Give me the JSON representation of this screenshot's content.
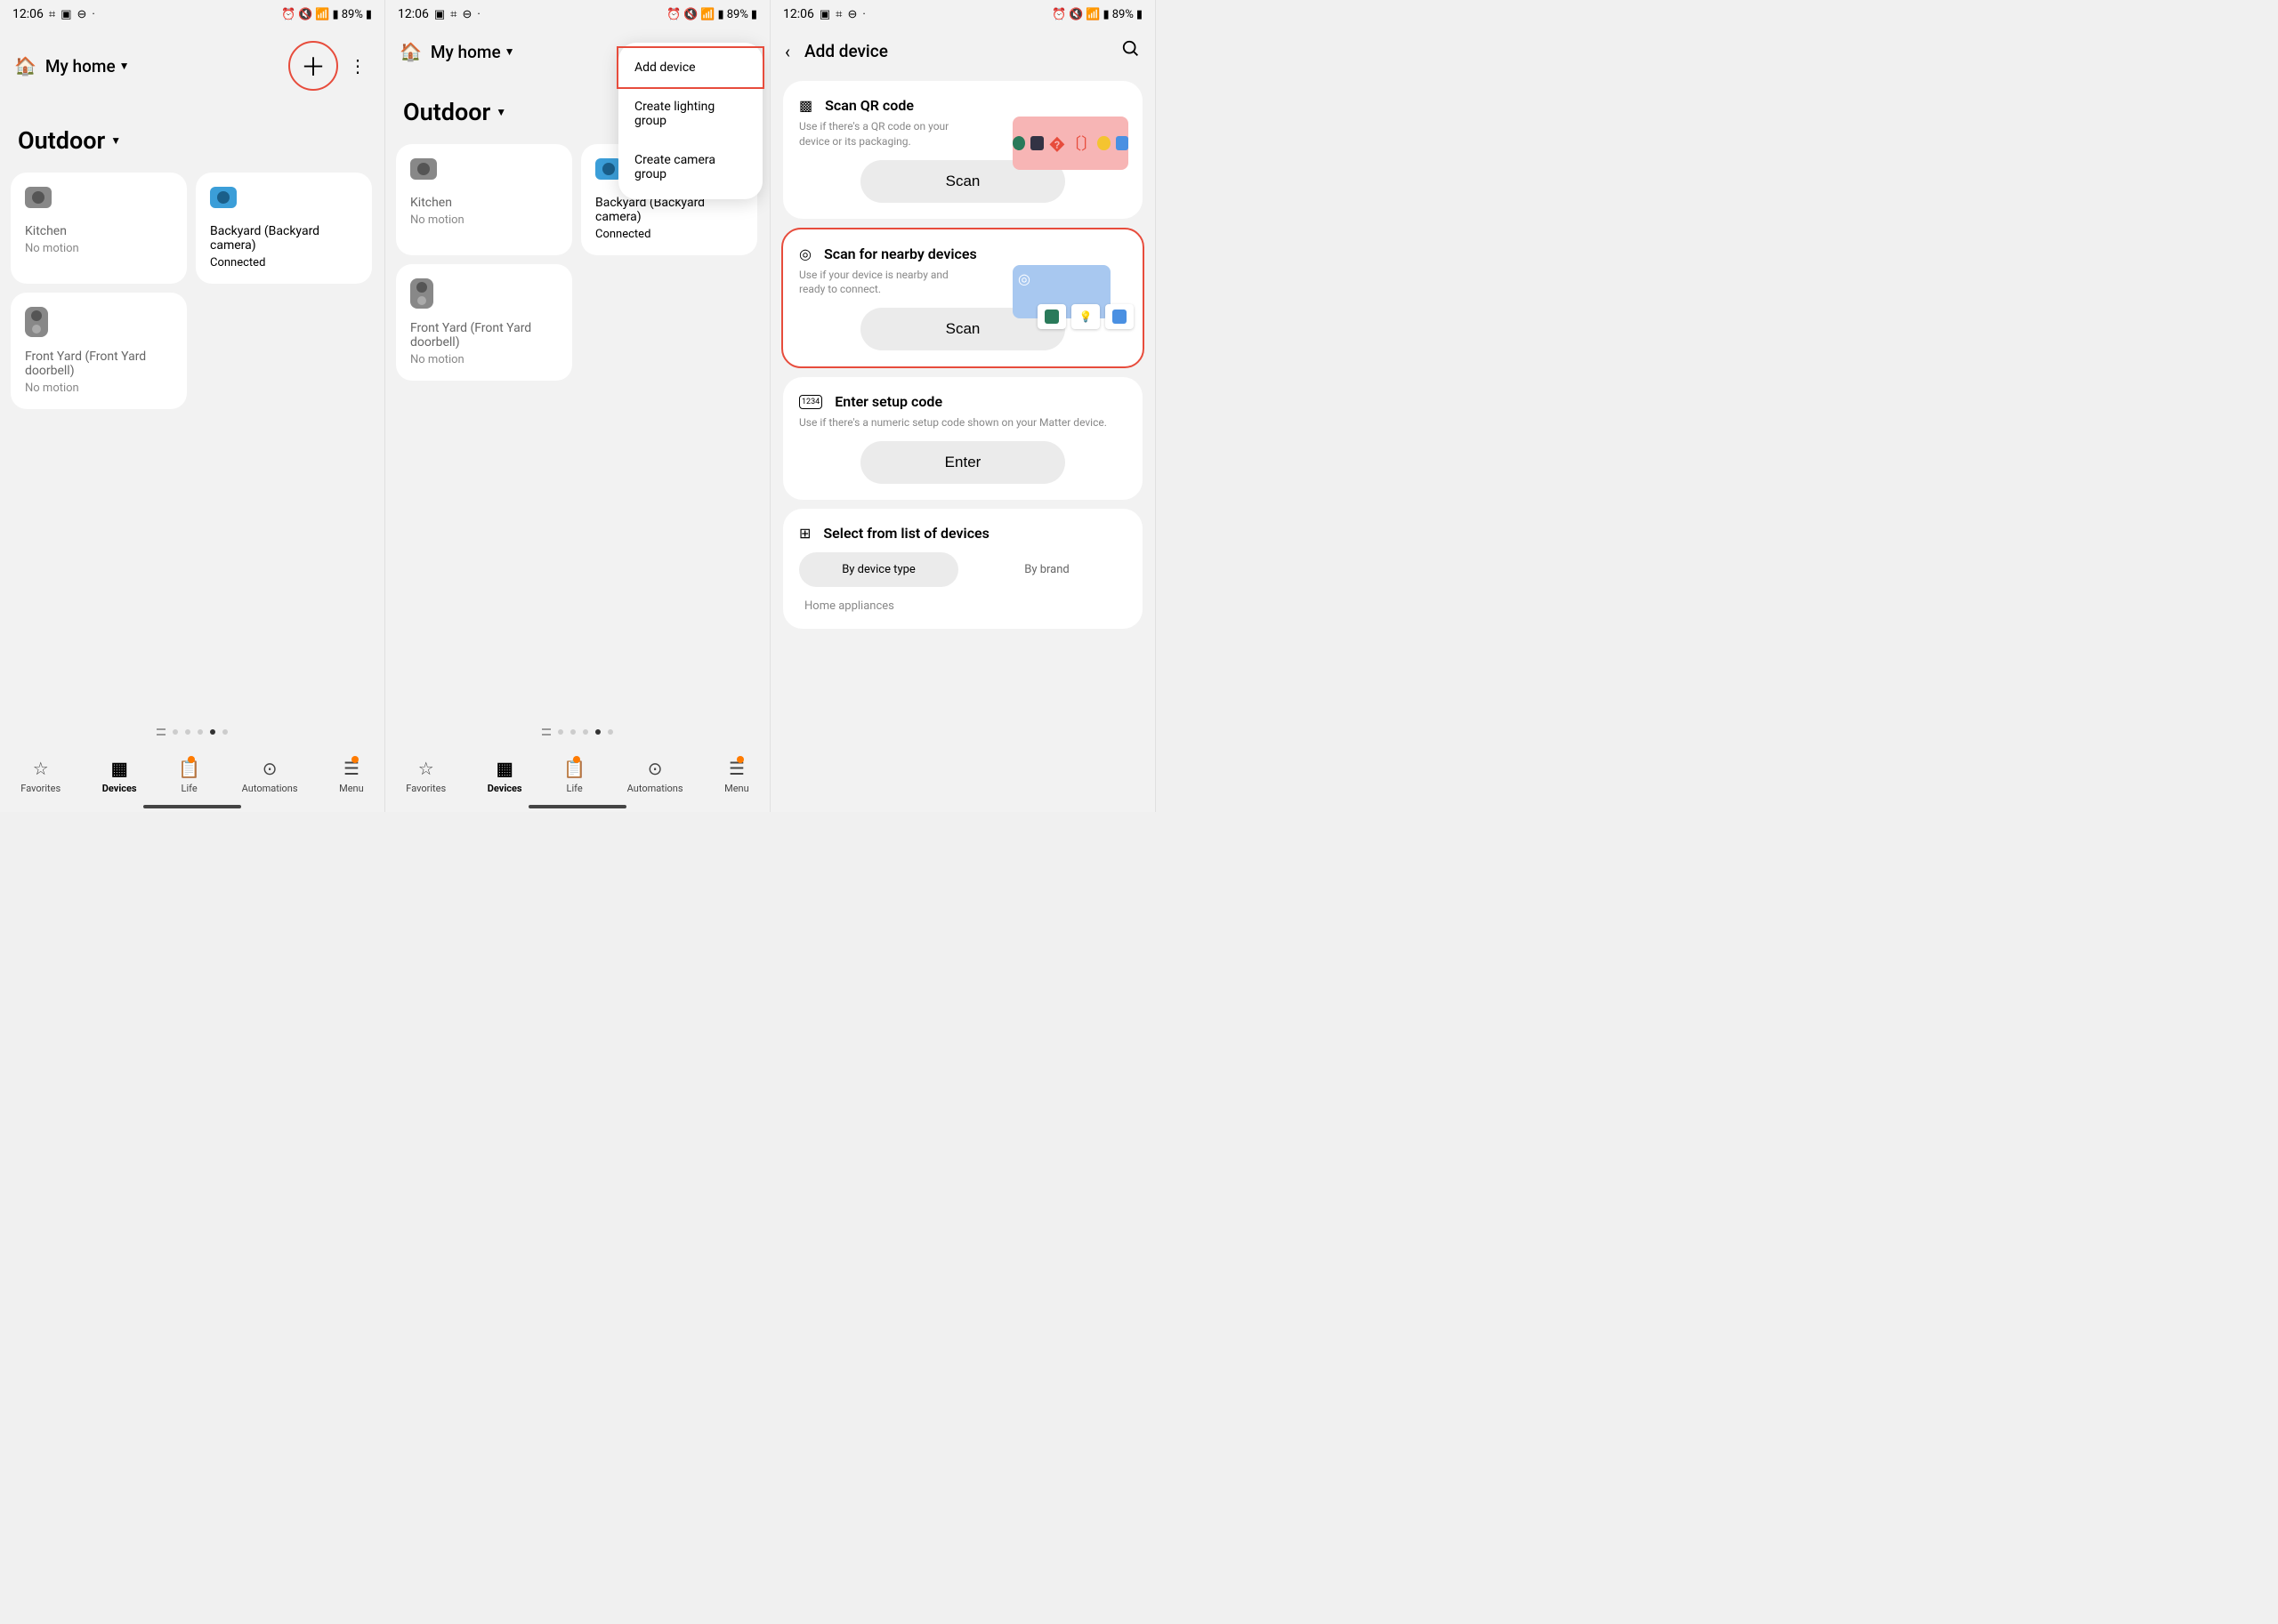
{
  "status": {
    "time": "12:06",
    "battery": "89%"
  },
  "home": {
    "label": "My home",
    "section": "Outdoor"
  },
  "devices": {
    "kitchen": {
      "name": "Kitchen",
      "status": "No motion"
    },
    "backyard": {
      "name": "Backyard (Backyard camera)",
      "status": "Connected"
    },
    "frontyard": {
      "name": "Front Yard (Front Yard doorbell)",
      "status": "No motion"
    }
  },
  "nav": {
    "favorites": "Favorites",
    "devices": "Devices",
    "life": "Life",
    "automations": "Automations",
    "menu": "Menu"
  },
  "dropdown": {
    "add_device": "Add device",
    "create_lighting": "Create lighting group",
    "create_camera": "Create camera group"
  },
  "add": {
    "title": "Add device",
    "qr": {
      "title": "Scan QR code",
      "desc": "Use if there's a QR code on your device or its packaging.",
      "button": "Scan"
    },
    "nearby": {
      "title": "Scan for nearby devices",
      "desc": "Use if your device is nearby and ready to connect.",
      "button": "Scan"
    },
    "setup": {
      "title": "Enter setup code",
      "desc": "Use if there's a numeric setup code shown on your Matter device.",
      "button": "Enter"
    },
    "select": {
      "title": "Select from list of devices",
      "by_type": "By device type",
      "by_brand": "By brand",
      "sub": "Home appliances"
    }
  }
}
